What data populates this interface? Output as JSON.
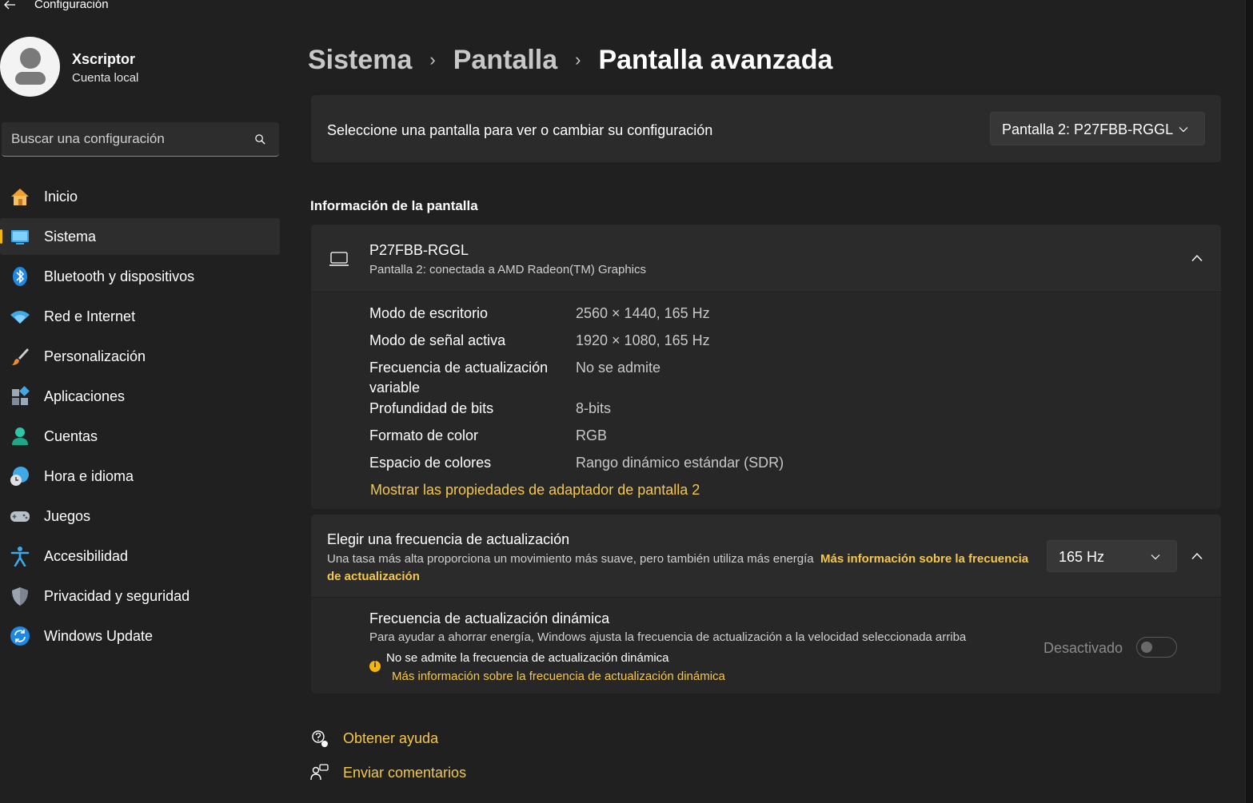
{
  "window": {
    "title": "Configuración"
  },
  "profile": {
    "name": "Xscriptor",
    "account_type": "Cuenta local"
  },
  "search": {
    "placeholder": "Buscar una configuración"
  },
  "nav": {
    "items": [
      {
        "label": "Inicio",
        "icon": "home-icon"
      },
      {
        "label": "Sistema",
        "icon": "system-icon",
        "active": true
      },
      {
        "label": "Bluetooth y dispositivos",
        "icon": "bluetooth-icon"
      },
      {
        "label": "Red e Internet",
        "icon": "wifi-icon"
      },
      {
        "label": "Personalización",
        "icon": "brush-icon"
      },
      {
        "label": "Aplicaciones",
        "icon": "apps-icon"
      },
      {
        "label": "Cuentas",
        "icon": "accounts-icon"
      },
      {
        "label": "Hora e idioma",
        "icon": "time-language-icon"
      },
      {
        "label": "Juegos",
        "icon": "gamepad-icon"
      },
      {
        "label": "Accesibilidad",
        "icon": "accessibility-icon"
      },
      {
        "label": "Privacidad y seguridad",
        "icon": "shield-icon"
      },
      {
        "label": "Windows Update",
        "icon": "update-icon"
      }
    ]
  },
  "breadcrumb": [
    "Sistema",
    "Pantalla",
    "Pantalla avanzada"
  ],
  "display_select": {
    "label": "Seleccione una pantalla para ver o cambiar su configuración",
    "value": "Pantalla 2: P27FBB-RGGL"
  },
  "info_section": {
    "title": "Información de la pantalla",
    "monitor_name": "P27FBB-RGGL",
    "monitor_subtitle": "Pantalla 2: conectada a AMD Radeon(TM) Graphics",
    "rows": [
      {
        "key": "Modo de escritorio",
        "value": "2560 × 1440, 165 Hz"
      },
      {
        "key": "Modo de señal activa",
        "value": "1920 × 1080, 165 Hz"
      },
      {
        "key": "Frecuencia de actualización variable",
        "value": "No se admite"
      },
      {
        "key": "Profundidad de bits",
        "value": "8-bits"
      },
      {
        "key": "Formato de color",
        "value": "RGB"
      },
      {
        "key": "Espacio de colores",
        "value": "Rango dinámico estándar (SDR)"
      }
    ],
    "adapter_link": "Mostrar las propiedades de adaptador de pantalla 2"
  },
  "refresh": {
    "title": "Elegir una frecuencia de actualización",
    "description": "Una tasa más alta proporciona un movimiento más suave, pero también utiliza más energía",
    "more_info_link": "Más información sobre la frecuencia de actualización",
    "value": "165 Hz",
    "dynamic": {
      "title": "Frecuencia de actualización dinámica",
      "description": "Para ayudar a ahorrar energía, Windows ajusta la frecuencia de actualización a la velocidad seleccionada arriba",
      "warning": "No se admite la frecuencia de actualización dinámica",
      "warning_link": "Más información sobre la frecuencia de actualización dinámica",
      "toggle_label": "Desactivado",
      "toggle_on": false
    }
  },
  "footer": {
    "help": "Obtener ayuda",
    "feedback": "Enviar comentarios"
  },
  "colors": {
    "accent": "#f5b50a",
    "link": "#f5c74a",
    "background": "#202020",
    "card": "#2b2b2b"
  }
}
